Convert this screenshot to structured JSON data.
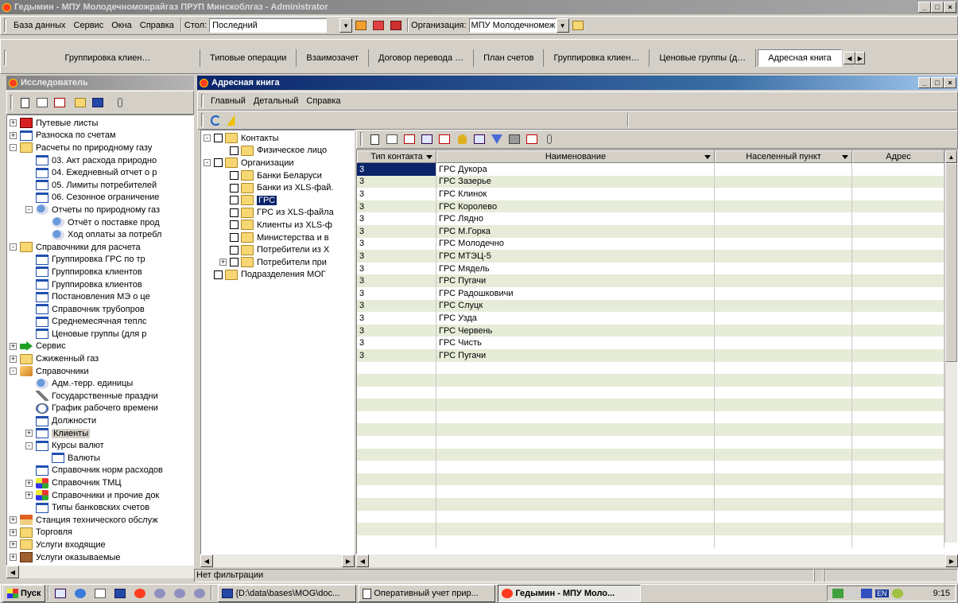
{
  "main_window": {
    "title": "Гедымин - МПУ Молодечноможрайгаз ПРУП Минскоблгаз - Administrator",
    "window_controls": [
      "_",
      "□",
      "×"
    ]
  },
  "menu": {
    "items": [
      "База данных",
      "Сервис",
      "Окна",
      "Справка"
    ],
    "desk_label": "Стол:",
    "desk_value": "Последний",
    "org_label": "Организация:",
    "org_value": "МПУ Молодечномежрайг"
  },
  "tabs": {
    "items": [
      {
        "label": "Группировка клиен…",
        "active": false
      },
      {
        "label": "Типовые операции",
        "active": false
      },
      {
        "label": "Взаимозачет",
        "active": false
      },
      {
        "label": "Договор перевода …",
        "active": false
      },
      {
        "label": "План счетов",
        "active": false
      },
      {
        "label": "Группировка клиен…",
        "active": false
      },
      {
        "label": "Ценовые группы (д…",
        "active": false
      },
      {
        "label": "Адресная книга",
        "active": true
      }
    ]
  },
  "explorer": {
    "title": "Исследователь",
    "tree": [
      {
        "label": "Путевые листы",
        "level": 0,
        "exp": "+",
        "icon": "red"
      },
      {
        "label": "Разноска по счетам",
        "level": 0,
        "exp": "+",
        "icon": "window"
      },
      {
        "label": "Расчеты по природному газу",
        "level": 0,
        "exp": "-",
        "icon": "folder"
      },
      {
        "label": "03. Акт расхода природно",
        "level": 1,
        "exp": "",
        "icon": "window"
      },
      {
        "label": "04. Ежедневный отчет о р",
        "level": 1,
        "exp": "",
        "icon": "window"
      },
      {
        "label": "05. Лимиты потребителей",
        "level": 1,
        "exp": "",
        "icon": "window"
      },
      {
        "label": "06. Сезонное ограничение",
        "level": 1,
        "exp": "",
        "icon": "window"
      },
      {
        "label": "Отчеты по природному газ",
        "level": 1,
        "exp": "-",
        "icon": "people"
      },
      {
        "label": "Отчёт о поставке прод",
        "level": 2,
        "exp": "",
        "icon": "people"
      },
      {
        "label": "Ход оплаты за потребл",
        "level": 2,
        "exp": "",
        "icon": "people"
      },
      {
        "label": "Справочники для расчета",
        "level": 0,
        "exp": "-",
        "icon": "folder",
        "indent_half": true
      },
      {
        "label": "Группировка ГРС по тр",
        "level": 1,
        "exp": "",
        "icon": "window"
      },
      {
        "label": "Группировка клиентов",
        "level": 1,
        "exp": "",
        "icon": "window"
      },
      {
        "label": "Группировка клиентов",
        "level": 1,
        "exp": "",
        "icon": "window"
      },
      {
        "label": "Постановления МЭ о це",
        "level": 1,
        "exp": "",
        "icon": "window"
      },
      {
        "label": "Справочник трубопров",
        "level": 1,
        "exp": "",
        "icon": "window"
      },
      {
        "label": "Среднемесячная теплс",
        "level": 1,
        "exp": "",
        "icon": "window"
      },
      {
        "label": "Ценовые группы (для р",
        "level": 1,
        "exp": "",
        "icon": "window"
      },
      {
        "label": "Сервис",
        "level": 0,
        "exp": "+",
        "icon": "arrow"
      },
      {
        "label": "Сжиженный газ",
        "level": 0,
        "exp": "+",
        "icon": "folder"
      },
      {
        "label": "Справочники",
        "level": 0,
        "exp": "-",
        "icon": "cube"
      },
      {
        "label": "Адм.-терр. единицы",
        "level": 1,
        "exp": "",
        "icon": "people"
      },
      {
        "label": "Государственные праздни",
        "level": 1,
        "exp": "",
        "icon": "hammer"
      },
      {
        "label": "График рабочего времени",
        "level": 1,
        "exp": "",
        "icon": "clock"
      },
      {
        "label": "Должности",
        "level": 1,
        "exp": "",
        "icon": "window"
      },
      {
        "label": "Клиенты",
        "level": 1,
        "exp": "+",
        "icon": "window",
        "highlight": true
      },
      {
        "label": "Курсы валют",
        "level": 1,
        "exp": "-",
        "icon": "window"
      },
      {
        "label": "Валюты",
        "level": 2,
        "exp": "",
        "icon": "window"
      },
      {
        "label": "Справочник норм расходов",
        "level": 1,
        "exp": "",
        "icon": "window"
      },
      {
        "label": "Справочник ТМЦ",
        "level": 1,
        "exp": "+",
        "icon": "colorful"
      },
      {
        "label": "Справочники и прочие док",
        "level": 1,
        "exp": "+",
        "icon": "colorful"
      },
      {
        "label": "Типы банковских счетов",
        "level": 1,
        "exp": "",
        "icon": "window"
      },
      {
        "label": "Станция технического обслуж",
        "level": 0,
        "exp": "+",
        "icon": "house"
      },
      {
        "label": "Торговля",
        "level": 0,
        "exp": "+",
        "icon": "folder"
      },
      {
        "label": "Услуги входящие",
        "level": 0,
        "exp": "+",
        "icon": "folder"
      },
      {
        "label": "Услуги оказываемые",
        "level": 0,
        "exp": "+",
        "icon": "brown"
      }
    ]
  },
  "address_book": {
    "title": "Адресная книга",
    "menu": [
      "Главный",
      "Детальный",
      "Справка"
    ],
    "tree": [
      {
        "label": "Контакты",
        "level": 0,
        "exp": "-"
      },
      {
        "label": "Физическое лицо",
        "level": 1,
        "exp": ""
      },
      {
        "label": "Организации",
        "level": 0,
        "exp": "-"
      },
      {
        "label": "Банки Беларуси",
        "level": 1,
        "exp": ""
      },
      {
        "label": "Банки из XLS-фай.",
        "level": 1,
        "exp": ""
      },
      {
        "label": "ГРС",
        "level": 1,
        "exp": "",
        "selected": true
      },
      {
        "label": "ГРС из XLS-файла",
        "level": 1,
        "exp": ""
      },
      {
        "label": "Клиенты из XLS-ф",
        "level": 1,
        "exp": ""
      },
      {
        "label": "Министерства и в",
        "level": 1,
        "exp": ""
      },
      {
        "label": "Потребители из Х",
        "level": 1,
        "exp": ""
      },
      {
        "label": "Потребители при",
        "level": 1,
        "exp": "+"
      },
      {
        "label": "Подразделения МОГ",
        "level": 0,
        "exp": ""
      }
    ],
    "columns": [
      {
        "label": "Тип контакта",
        "filter": true
      },
      {
        "label": "Наименование",
        "filter": true
      },
      {
        "label": "Населенный пункт",
        "filter": true
      },
      {
        "label": "Адрес",
        "filter": false
      }
    ],
    "rows": [
      {
        "type": "3",
        "name": "ГРС Дукора"
      },
      {
        "type": "3",
        "name": "ГРС Зазерье"
      },
      {
        "type": "3",
        "name": "ГРС Клинок"
      },
      {
        "type": "3",
        "name": "ГРС Королево"
      },
      {
        "type": "3",
        "name": "ГРС Лядно"
      },
      {
        "type": "3",
        "name": "ГРС М.Горка"
      },
      {
        "type": "3",
        "name": "ГРС Молодечно"
      },
      {
        "type": "3",
        "name": "ГРС МТЭЦ-5"
      },
      {
        "type": "3",
        "name": "ГРС Мядель"
      },
      {
        "type": "3",
        "name": "ГРС Пугачи"
      },
      {
        "type": "3",
        "name": "ГРС Радошковичи"
      },
      {
        "type": "3",
        "name": "ГРС Слуцк"
      },
      {
        "type": "3",
        "name": "ГРС Узда"
      },
      {
        "type": "3",
        "name": "ГРС Червень"
      },
      {
        "type": "3",
        "name": "ГРС Чисть"
      },
      {
        "type": "3",
        "name": "ГРС Пугачи"
      }
    ],
    "status": "Нет фильтрации"
  },
  "taskbar": {
    "start": "Пуск",
    "tasks": [
      {
        "label": "{D:\\data\\bases\\MOG\\doc...",
        "pressed": false
      },
      {
        "label": "Оперативный учет прир...",
        "pressed": false
      },
      {
        "label": "Гедымин - МПУ Моло...",
        "pressed": true
      }
    ],
    "lang": "EN",
    "clock": "9:15"
  },
  "colors": {
    "title_active": "#0a246a",
    "face": "#d4d0c8",
    "grid_stripe": "#e6ecd8",
    "selection": "#0a246a"
  }
}
